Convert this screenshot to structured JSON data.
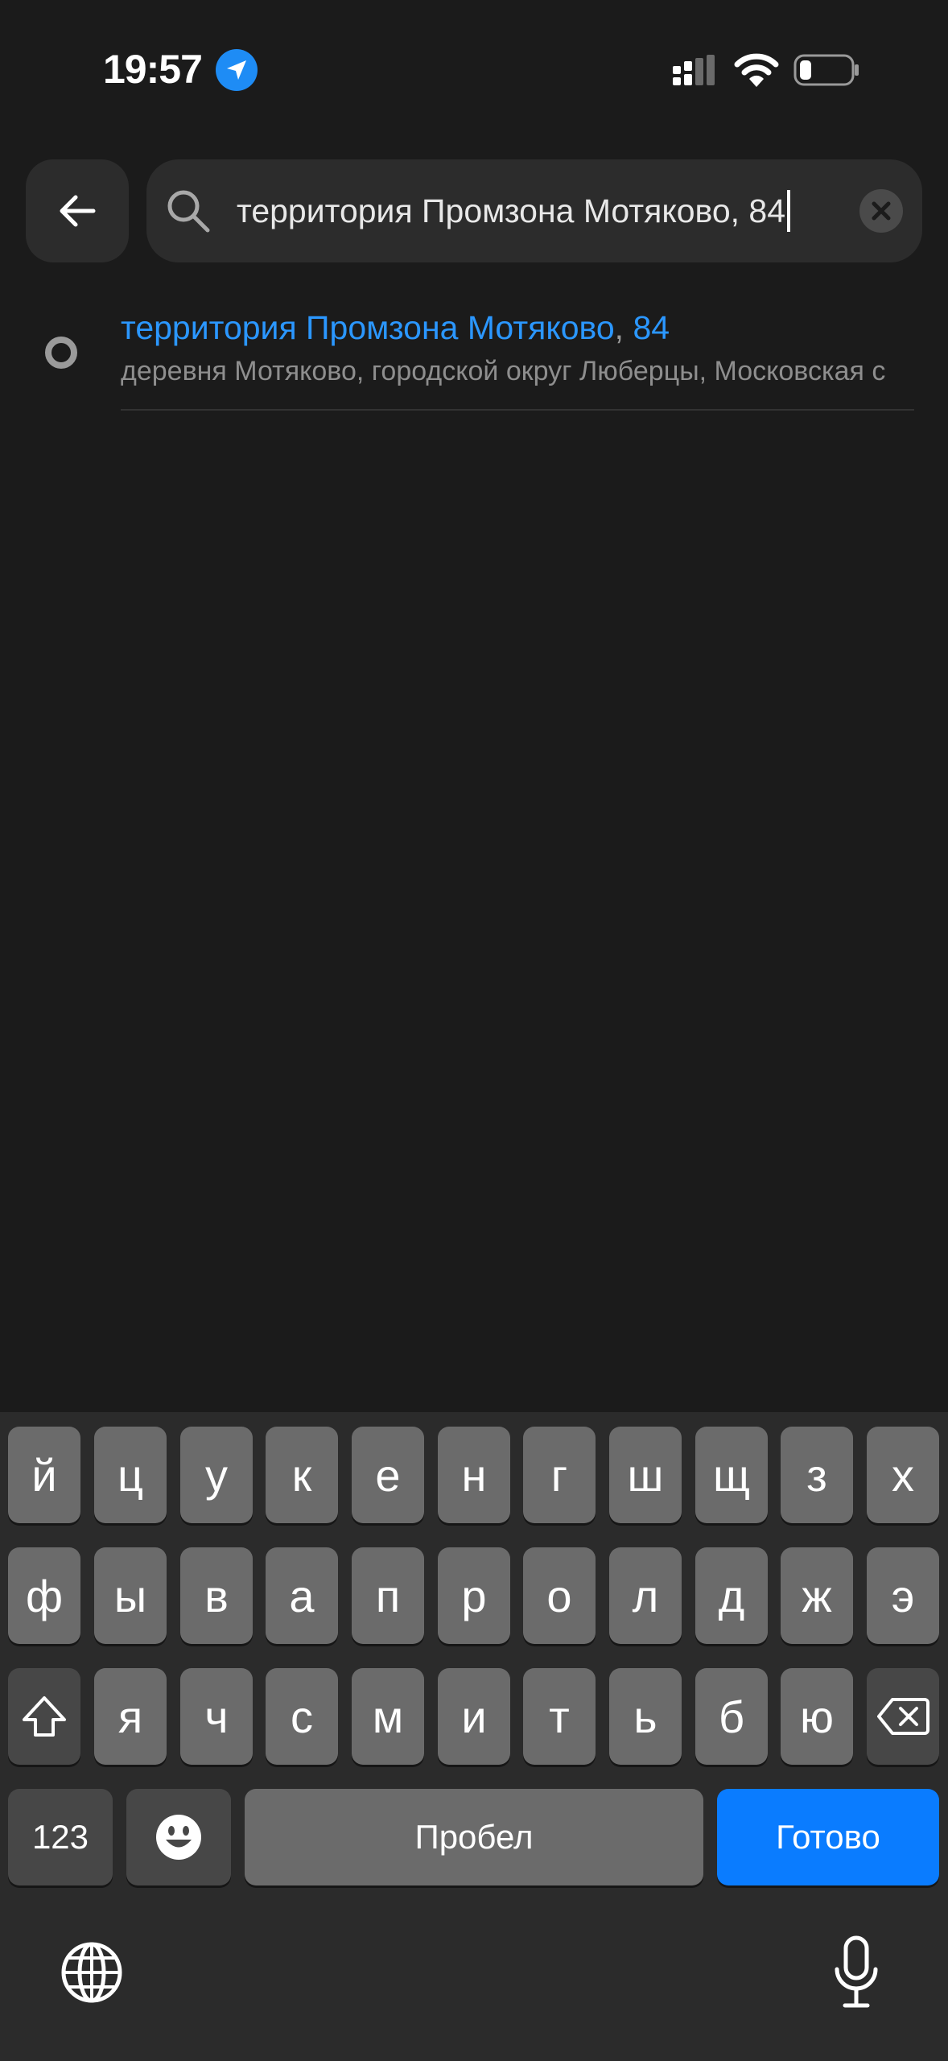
{
  "status_bar": {
    "time": "19:57",
    "icons": [
      "location-arrow-icon",
      "cellular-signal-icon",
      "wifi-icon",
      "battery-icon"
    ],
    "battery_level": 0.2
  },
  "search": {
    "back_icon": "arrow-left-icon",
    "search_icon": "search-icon",
    "value": "территория Промзона Мотяково, 84",
    "clear_icon": "close-icon"
  },
  "results": [
    {
      "title_match": "территория Промзона Мотяково",
      "title_sep": ", ",
      "title_number": "84",
      "subtitle": "деревня Мотяково, городской округ Люберцы, Московская с"
    }
  ],
  "keyboard": {
    "row1": [
      "й",
      "ц",
      "у",
      "к",
      "е",
      "н",
      "г",
      "ш",
      "щ",
      "з",
      "х"
    ],
    "row2": [
      "ф",
      "ы",
      "в",
      "а",
      "п",
      "р",
      "о",
      "л",
      "д",
      "ж",
      "э"
    ],
    "row3": [
      "я",
      "ч",
      "с",
      "м",
      "и",
      "т",
      "ь",
      "б",
      "ю"
    ],
    "numbers_label": "123",
    "space_label": "Пробел",
    "done_label": "Готово",
    "icons": [
      "shift-icon",
      "backspace-icon",
      "emoji-icon",
      "globe-icon",
      "microphone-icon"
    ]
  },
  "colors": {
    "background": "#1b1b1b",
    "accent": "#2b97ff",
    "done_key": "#0a7cff"
  }
}
